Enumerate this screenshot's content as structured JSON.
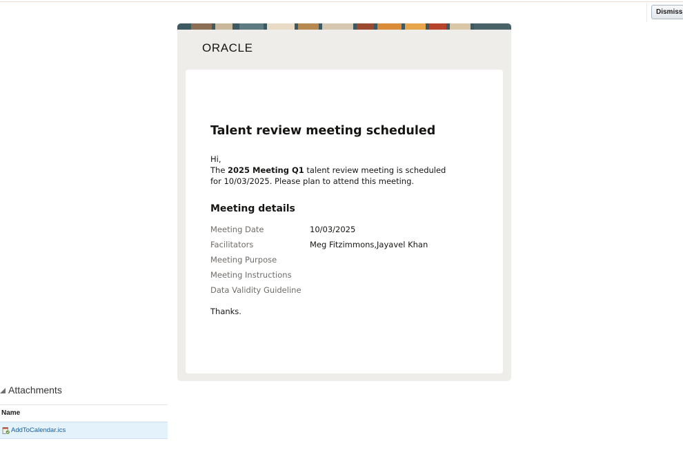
{
  "toolbar": {
    "dismiss_label": "Dismiss"
  },
  "email": {
    "brand": "ORACLE",
    "title": "Talent review meeting scheduled",
    "greeting": "Hi,",
    "body_prefix": "The ",
    "meeting_name": "2025 Meeting Q1",
    "body_suffix": " talent review meeting is scheduled for 10/03/2025. Please plan to attend this meeting.",
    "details_title": "Meeting details",
    "details": [
      {
        "label": "Meeting Date",
        "value": "10/03/2025"
      },
      {
        "label": "Facilitators",
        "value": "Meg Fitzimmons,Jayavel Khan"
      },
      {
        "label": "Meeting Purpose",
        "value": ""
      },
      {
        "label": "Meeting Instructions",
        "value": ""
      },
      {
        "label": "Data Validity Guideline",
        "value": ""
      }
    ],
    "closing": "Thanks."
  },
  "attachments": {
    "title": "Attachments",
    "column_name": "Name",
    "files": [
      {
        "name": "AddToCalendar.ics",
        "icon": "calendar-file-icon"
      }
    ]
  },
  "colors": {
    "card_background": "#efedea",
    "panel_background": "#ffffff",
    "label_text": "#6f6c69",
    "link": "#145c9e",
    "selected_row": "#e4f2fb"
  }
}
